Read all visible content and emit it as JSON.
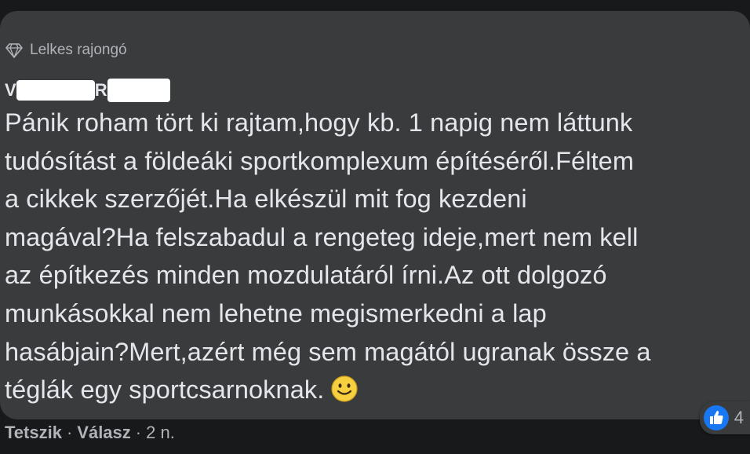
{
  "comment": {
    "badge_label": "Lelkes rajongó",
    "author_initial": "V",
    "author_initial_2": "R",
    "text": "Pánik roham tört ki rajtam,hogy kb. 1 napig nem láttunk\ntudósítást a földeáki sportkomplexum építéséről.Féltem\na cikkek szerzőjét.Ha elkészül mit fog kezdeni\nmagával?Ha felszabadul a rengeteg ideje,mert nem kell\naz építkezés minden mozdulatáról írni.Az ott dolgozó\nmunkásokkal nem lehetne megismerkedni a lap\nhasábjain?Mert,azért még sem magától ugranak össze a\ntéglák egy sportcsarnoknak.",
    "emoji": "slightly-smiling-face-icon",
    "reaction_icon": "like-icon",
    "reaction_count": "4"
  },
  "actions": {
    "like_label": "Tetszik",
    "reply_label": "Válasz",
    "separator": "·",
    "timestamp": "2 n."
  },
  "colors": {
    "background": "#18191a",
    "bubble": "#3a3b3c",
    "text": "#e4e6eb",
    "secondary_text": "#b0b3b8",
    "like_blue": "#1877f2",
    "emoji_yellow": "#f7d040"
  }
}
